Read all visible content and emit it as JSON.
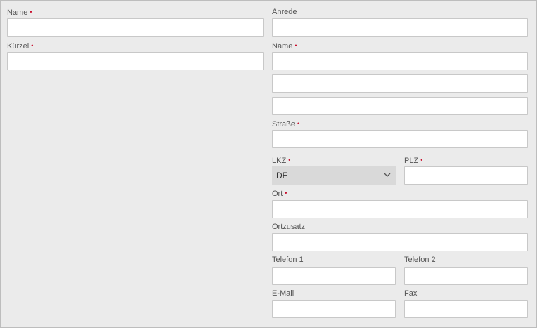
{
  "left": {
    "name_label": "Name",
    "kuerzel_label": "Kürzel",
    "name_value": "",
    "kuerzel_value": ""
  },
  "right": {
    "anrede_label": "Anrede",
    "name_label": "Name",
    "strasse_label": "Straße",
    "lkz_label": "LKZ",
    "lkz_value": "DE",
    "plz_label": "PLZ",
    "ort_label": "Ort",
    "ortzusatz_label": "Ortzusatz",
    "telefon1_label": "Telefon 1",
    "telefon2_label": "Telefon 2",
    "email_label": "E-Mail",
    "fax_label": "Fax"
  },
  "required_marker": "•",
  "colors": {
    "background": "#ebebeb",
    "required": "#c8102e",
    "input_border": "#c8c8c8",
    "select_background": "#d9d9d9"
  }
}
